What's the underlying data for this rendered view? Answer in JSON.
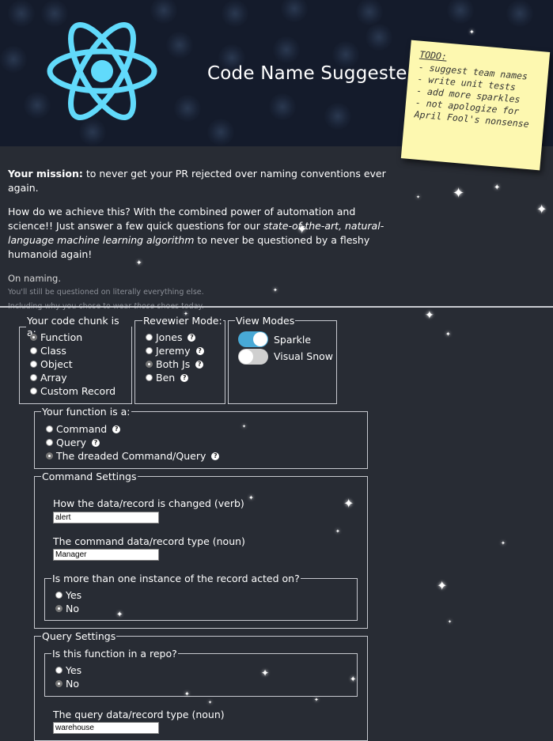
{
  "header": {
    "title": "Code Name Suggester",
    "logo": "react-atom-logo"
  },
  "sticky_note": {
    "title": "TODO:",
    "items": [
      "- suggest team names",
      "- write unit tests",
      "- add more sparkles",
      "- not apologize for",
      "April Fool's nonsense"
    ]
  },
  "intro": {
    "mission_bold": "Your mission:",
    "mission_text": " to never get your PR rejected over naming conventions ever again.",
    "how_text_1": "How do we achieve this? With the combined power of automation and science!! Just answer a few quick questions for our ",
    "how_italic": "state-of-the-art, natural-language machine learning algorithm",
    "how_text_2": " to never be questioned by a fleshy humanoid again!",
    "naming": "On naming.",
    "note1": "You'll still be questioned on literally everything else.",
    "note2_a": "Including why you chose to wear ",
    "note2_italic": "those",
    "note2_b": " shoes today."
  },
  "code_chunk": {
    "legend": "Your code chunk is a:",
    "options": [
      "Function",
      "Class",
      "Object",
      "Array",
      "Custom Record"
    ],
    "selected": "Function"
  },
  "reviewer_mode": {
    "legend": "Revewier Mode:",
    "options": [
      "Jones",
      "Jeremy",
      "Both Js",
      "Ben"
    ],
    "selected": "Both Js"
  },
  "view_modes": {
    "legend": "View Modes",
    "toggles": [
      {
        "label": "Sparkle",
        "on": true
      },
      {
        "label": "Visual Snow",
        "on": false
      }
    ]
  },
  "function_type": {
    "legend": "Your function is a:",
    "options": [
      "Command",
      "Query",
      "The dreaded Command/Query"
    ],
    "selected": "The dreaded Command/Query"
  },
  "command_settings": {
    "legend": "Command Settings",
    "verb_label": "How the data/record is changed (verb)",
    "verb_value": "alert",
    "noun_label": "The command data/record type (noun)",
    "noun_value": "Manager",
    "multi_legend": "Is more than one instance of the record acted on?",
    "multi_options": [
      "Yes",
      "No"
    ],
    "multi_selected": "No"
  },
  "query_settings": {
    "legend": "Query Settings",
    "repo_legend": "Is this function in a repo?",
    "repo_options": [
      "Yes",
      "No"
    ],
    "repo_selected": "No",
    "noun_label": "The query data/record type (noun)",
    "noun_value": "warehouse"
  },
  "colors": {
    "background": "#282c34",
    "header": "#141b2b",
    "accent": "#61dafb",
    "toggle_on": "#48a9d6"
  }
}
